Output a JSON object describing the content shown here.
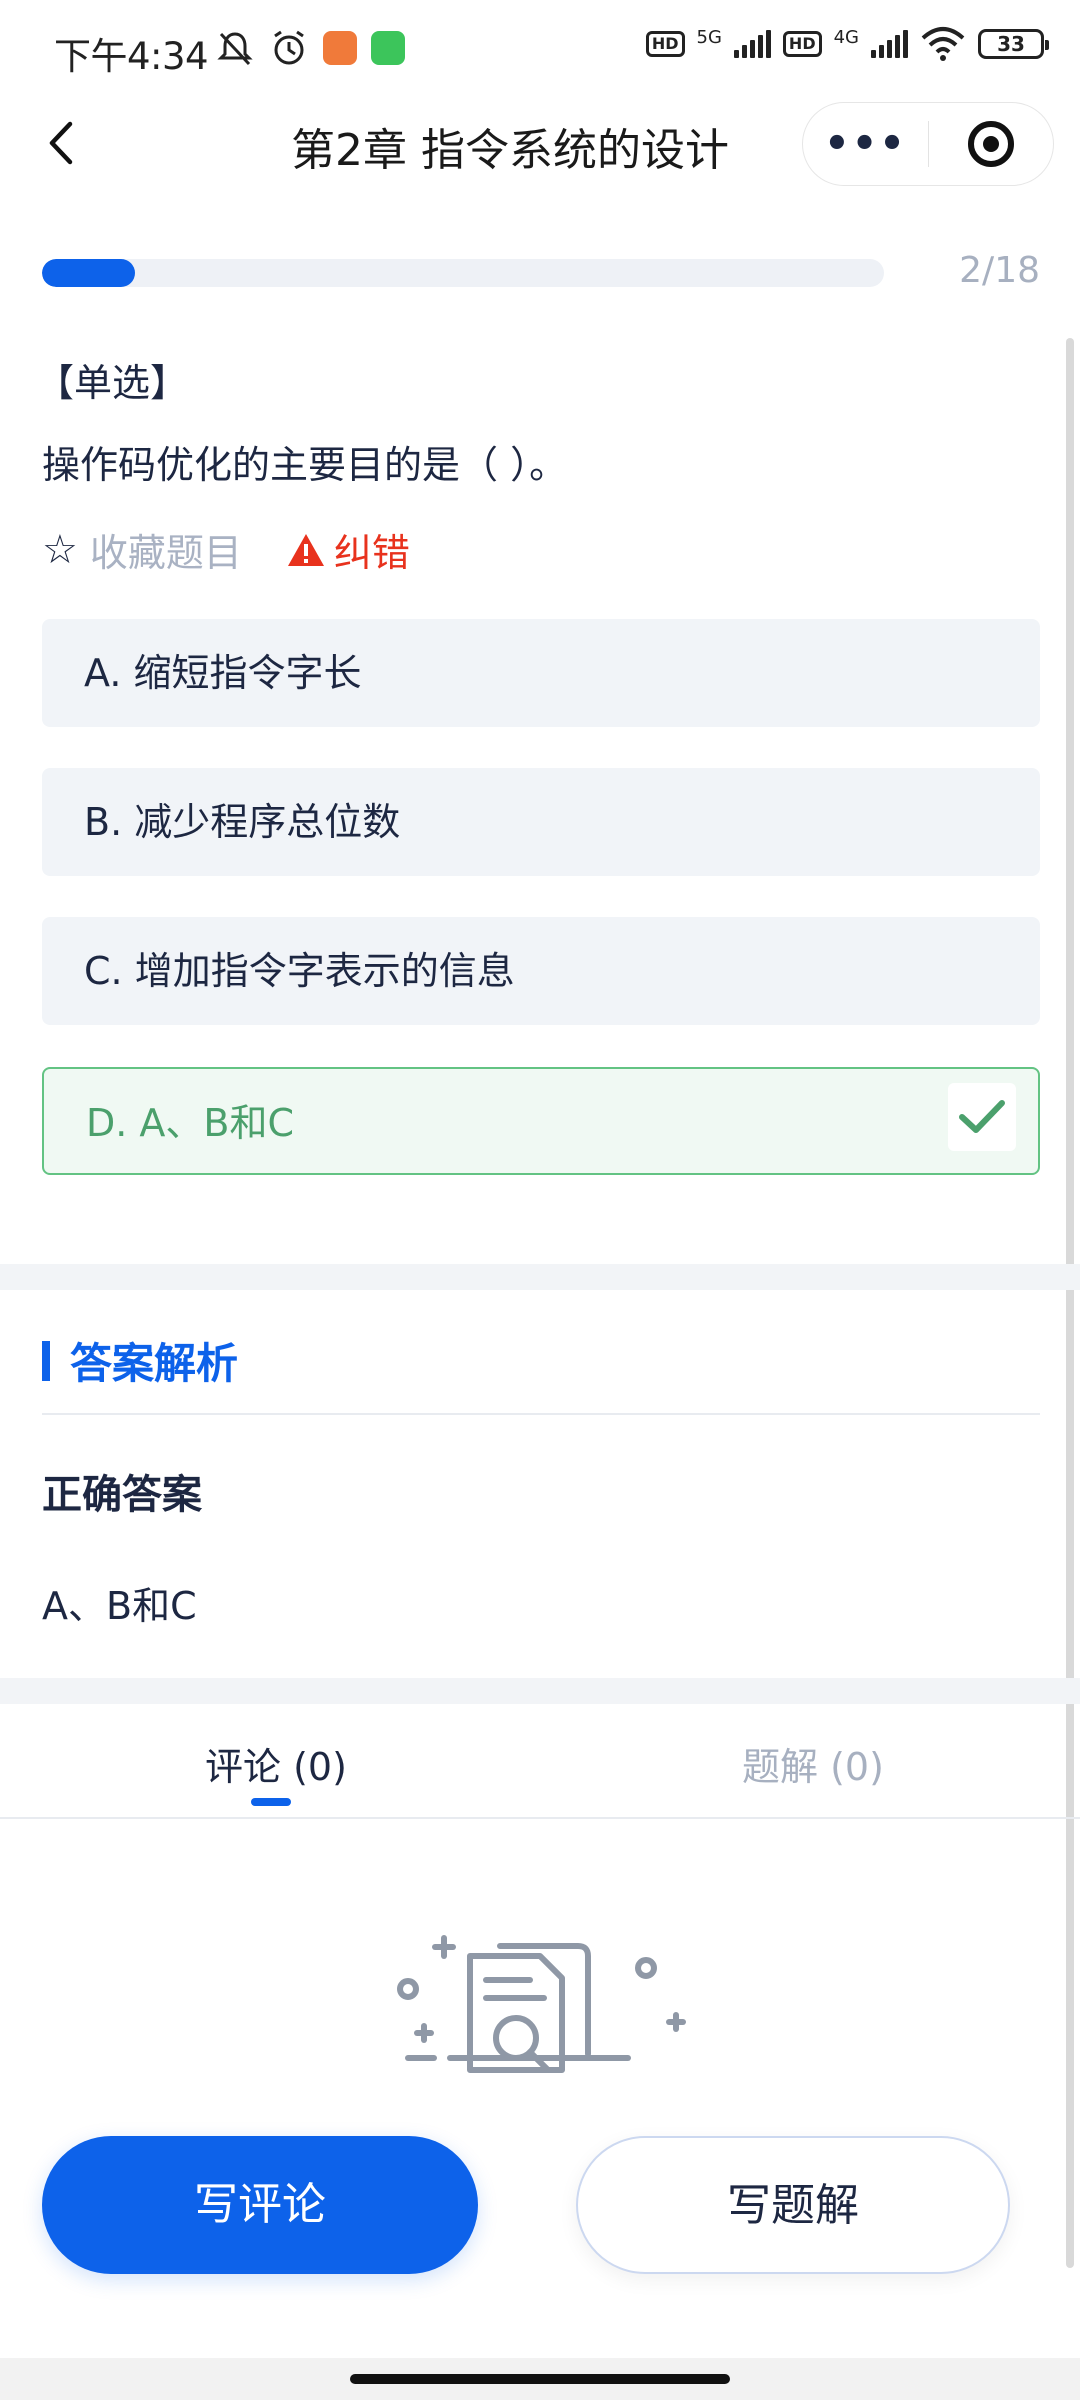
{
  "status_bar": {
    "time": "下午4:34",
    "network_1": "5G",
    "network_2": "4G",
    "hd_label": "HD",
    "battery": "33"
  },
  "nav": {
    "title": "第2章  指令系统的设计",
    "more_label": "•••"
  },
  "progress": {
    "current": 2,
    "total": 18,
    "text": "2/18",
    "fraction": 0.111
  },
  "question": {
    "type": "【单选】",
    "text": "操作码优化的主要目的是（    ）。",
    "favorite_label": "收藏题目",
    "report_label": "纠错",
    "options": [
      {
        "label": "A. 缩短指令字长",
        "correct": false
      },
      {
        "label": "B. 减少程序总位数",
        "correct": false
      },
      {
        "label": "C. 增加指令字表示的信息",
        "correct": false
      },
      {
        "label": "D. A、B和C",
        "correct": true
      }
    ]
  },
  "analysis": {
    "title": "答案解析",
    "correct_answer_label": "正确答案",
    "correct_answer_value": "A、B和C"
  },
  "tabs": {
    "comments": "评论 (0)",
    "solutions": "题解 (0)",
    "active": "comments"
  },
  "buttons": {
    "write_comment": "写评论",
    "write_solution": "写题解"
  },
  "colors": {
    "accent": "#0d62ea",
    "correct_green": "#4ba06c",
    "warning_red": "#e8321d",
    "muted": "#a7b0c0"
  },
  "icons": {
    "back": "chevron-left-icon",
    "more": "more-dots-icon",
    "target": "target-icon",
    "favorite": "star-outline-icon",
    "report": "warning-triangle-icon",
    "check": "checkmark-icon",
    "empty": "empty-document-search-icon"
  }
}
